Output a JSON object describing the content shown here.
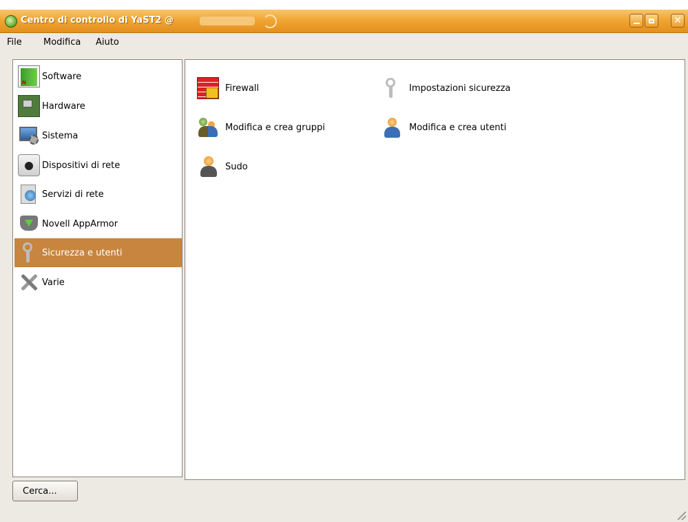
{
  "window": {
    "title": "Centro di controllo di YaST2 @"
  },
  "menu": [
    {
      "label": "File"
    },
    {
      "label": "Modifica"
    },
    {
      "label": "Aiuto"
    }
  ],
  "sidebar": {
    "items": [
      {
        "label": "Software",
        "icon": "software-icon"
      },
      {
        "label": "Hardware",
        "icon": "hardware-icon"
      },
      {
        "label": "Sistema",
        "icon": "system-icon"
      },
      {
        "label": "Dispositivi di rete",
        "icon": "network-devices-icon"
      },
      {
        "label": "Servizi di rete",
        "icon": "network-services-icon"
      },
      {
        "label": "Novell AppArmor",
        "icon": "apparmor-icon"
      },
      {
        "label": "Sicurezza e utenti",
        "icon": "keys-icon",
        "selected": true
      },
      {
        "label": "Varie",
        "icon": "tools-icon"
      }
    ],
    "selected_color": "#c8853f"
  },
  "modules": [
    {
      "label": "Firewall",
      "icon": "firewall-icon"
    },
    {
      "label": "Impostazioni sicurezza",
      "icon": "keys-icon"
    },
    {
      "label": "Modifica e crea gruppi",
      "icon": "groups-icon"
    },
    {
      "label": "Modifica e crea utenti",
      "icon": "user-icon"
    },
    {
      "label": "Sudo",
      "icon": "sudo-icon"
    }
  ],
  "footer": {
    "search_label": "Cerca..."
  },
  "colors": {
    "titlebar": "#f0a634",
    "window_bg": "#ede9e3"
  }
}
